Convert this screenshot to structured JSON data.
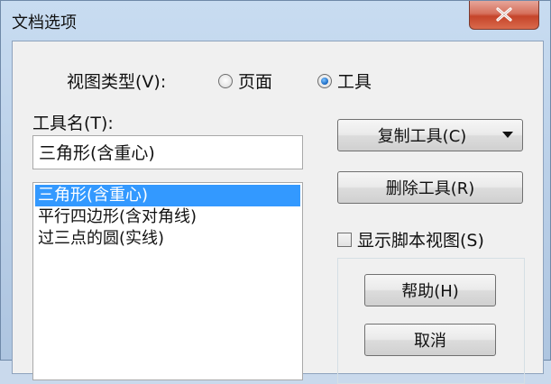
{
  "window": {
    "title": "文档选项",
    "close_icon": "close-icon"
  },
  "view_type": {
    "label": "视图类型(V):",
    "options": [
      {
        "label": "页面",
        "selected": false
      },
      {
        "label": "工具",
        "selected": true
      }
    ]
  },
  "tool_name": {
    "label": "工具名(T):",
    "value": "三角形(含重心)"
  },
  "tool_list": {
    "items": [
      {
        "label": "三角形(含重心)",
        "selected": true
      },
      {
        "label": "平行四边形(含对角线)",
        "selected": false
      },
      {
        "label": "过三点的圆(实线)",
        "selected": false
      }
    ]
  },
  "buttons": {
    "copy_tool": "复制工具(C)",
    "delete_tool": "删除工具(R)",
    "help": "帮助(H)",
    "cancel": "取消"
  },
  "show_script_view": {
    "label": "显示脚本视图(S)",
    "checked": false
  },
  "colors": {
    "selection": "#3399ff",
    "close_button": "#c5442a"
  }
}
